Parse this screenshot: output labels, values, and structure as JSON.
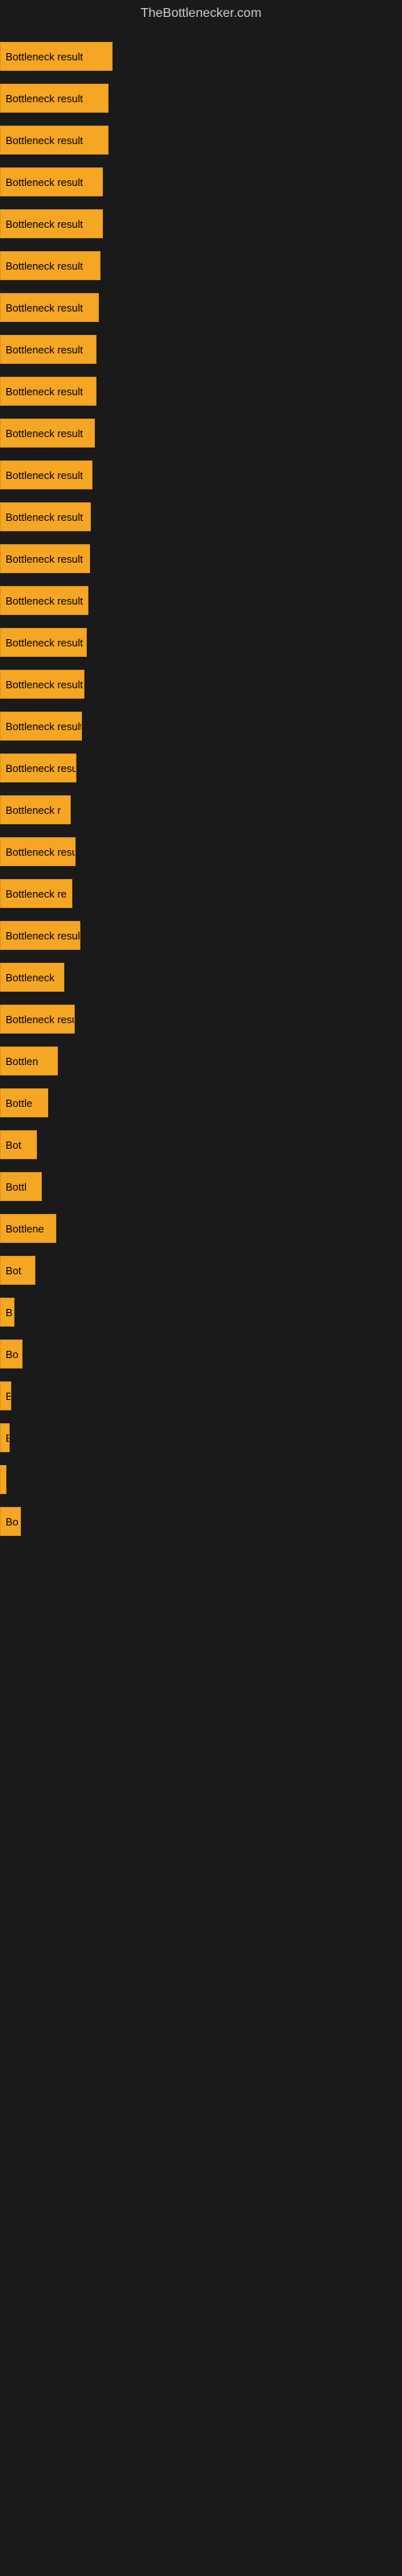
{
  "site": {
    "title": "TheBottlenecker.com"
  },
  "bars": [
    {
      "label": "Bottleneck result",
      "width": 140
    },
    {
      "label": "Bottleneck result",
      "width": 135
    },
    {
      "label": "Bottleneck result",
      "width": 135
    },
    {
      "label": "Bottleneck result",
      "width": 128
    },
    {
      "label": "Bottleneck result",
      "width": 128
    },
    {
      "label": "Bottleneck result",
      "width": 125
    },
    {
      "label": "Bottleneck result",
      "width": 123
    },
    {
      "label": "Bottleneck result",
      "width": 120
    },
    {
      "label": "Bottleneck result",
      "width": 120
    },
    {
      "label": "Bottleneck result",
      "width": 118
    },
    {
      "label": "Bottleneck result",
      "width": 115
    },
    {
      "label": "Bottleneck result",
      "width": 113
    },
    {
      "label": "Bottleneck result",
      "width": 112
    },
    {
      "label": "Bottleneck result",
      "width": 110
    },
    {
      "label": "Bottleneck result",
      "width": 108
    },
    {
      "label": "Bottleneck result",
      "width": 105
    },
    {
      "label": "Bottleneck result",
      "width": 102
    },
    {
      "label": "Bottleneck resu",
      "width": 95
    },
    {
      "label": "Bottleneck r",
      "width": 88
    },
    {
      "label": "Bottleneck resu",
      "width": 94
    },
    {
      "label": "Bottleneck re",
      "width": 90
    },
    {
      "label": "Bottleneck result",
      "width": 100
    },
    {
      "label": "Bottleneck",
      "width": 80
    },
    {
      "label": "Bottleneck resu",
      "width": 93
    },
    {
      "label": "Bottlen",
      "width": 72
    },
    {
      "label": "Bottle",
      "width": 60
    },
    {
      "label": "Bot",
      "width": 46
    },
    {
      "label": "Bottl",
      "width": 52
    },
    {
      "label": "Bottlene",
      "width": 70
    },
    {
      "label": "Bot",
      "width": 44
    },
    {
      "label": "B",
      "width": 18
    },
    {
      "label": "Bo",
      "width": 28
    },
    {
      "label": "B",
      "width": 14
    },
    {
      "label": "B",
      "width": 12
    },
    {
      "label": "",
      "width": 8
    },
    {
      "label": "Bo",
      "width": 26
    }
  ]
}
